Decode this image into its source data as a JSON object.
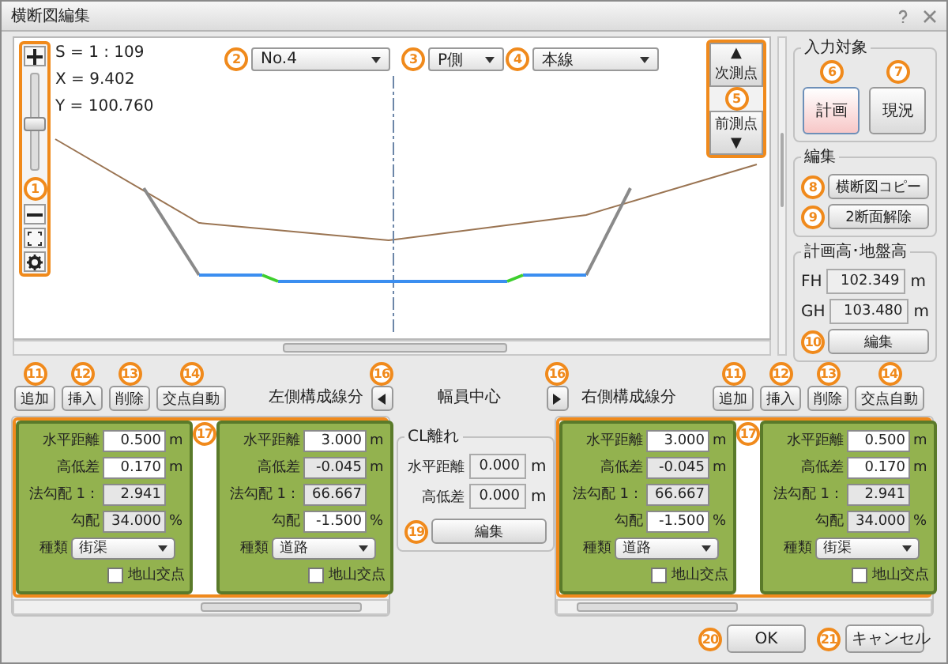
{
  "window": {
    "title": "横断図編集"
  },
  "canvas": {
    "scale": "S = 1 : 109",
    "x": "X = 9.402",
    "y": "Y = 100.760",
    "zoom_slider": {
      "level": 0.48
    },
    "dropdowns": [
      "No.4",
      "P側",
      "本線"
    ],
    "next_button": {
      "icon": "▲",
      "label": "次測点"
    },
    "prev_button": {
      "icon": "▼",
      "label": "前測点"
    }
  },
  "input_target": {
    "title": "入力対象",
    "buttons": [
      {
        "label": "計画",
        "selected": true
      },
      {
        "label": "現況",
        "selected": false
      }
    ]
  },
  "edit_group": {
    "title": "編集",
    "buttons": [
      "横断図コピー",
      "2断面解除"
    ]
  },
  "elevation": {
    "title": "計画高･地盤高",
    "rows": [
      {
        "label": "FH",
        "value": "102.349",
        "unit": "m"
      },
      {
        "label": "GH",
        "value": "103.480",
        "unit": "m"
      }
    ],
    "button": "編集"
  },
  "left_side": {
    "buttons": [
      "追加",
      "挿入",
      "削除",
      "交点自動"
    ],
    "title": "左側構成線分",
    "cards": [
      {
        "fields": [
          {
            "label": "水平距離",
            "value": "0.500",
            "unit": "m",
            "readonly": false
          },
          {
            "label": "高低差",
            "value": "0.170",
            "unit": "m",
            "readonly": false
          },
          {
            "label": "法勾配",
            "prefix": "1：",
            "value": "2.941",
            "readonly": true
          },
          {
            "label": "勾配",
            "value": "34.000",
            "unit": "%",
            "readonly": true
          }
        ],
        "type_label": "種類",
        "type_value": "街渠",
        "check_label": "地山交点",
        "checked": false
      },
      {
        "fields": [
          {
            "label": "水平距離",
            "value": "3.000",
            "unit": "m",
            "readonly": false
          },
          {
            "label": "高低差",
            "value": "-0.045",
            "unit": "m",
            "readonly": true
          },
          {
            "label": "法勾配",
            "prefix": "1：",
            "value": "66.667",
            "readonly": true
          },
          {
            "label": "勾配",
            "value": "-1.500",
            "unit": "%",
            "readonly": false
          }
        ],
        "type_label": "種類",
        "type_value": "道路",
        "check_label": "地山交点",
        "checked": false
      }
    ]
  },
  "center": {
    "title": "幅員中心",
    "group_title": "CL離れ",
    "fields": [
      {
        "label": "水平距離",
        "value": "0.000",
        "unit": "m"
      },
      {
        "label": "高低差",
        "value": "0.000",
        "unit": "m"
      }
    ],
    "button": "編集"
  },
  "right_side": {
    "buttons": [
      "追加",
      "挿入",
      "削除",
      "交点自動"
    ],
    "title": "右側構成線分",
    "cards": [
      {
        "fields": [
          {
            "label": "水平距離",
            "value": "3.000",
            "unit": "m",
            "readonly": false
          },
          {
            "label": "高低差",
            "value": "-0.045",
            "unit": "m",
            "readonly": true
          },
          {
            "label": "法勾配",
            "prefix": "1：",
            "value": "66.667",
            "readonly": true
          },
          {
            "label": "勾配",
            "value": "-1.500",
            "unit": "%",
            "readonly": false
          }
        ],
        "type_label": "種類",
        "type_value": "道路",
        "check_label": "地山交点",
        "checked": false
      },
      {
        "fields": [
          {
            "label": "水平距離",
            "value": "0.500",
            "unit": "m",
            "readonly": false
          },
          {
            "label": "高低差",
            "value": "0.170",
            "unit": "m",
            "readonly": false
          },
          {
            "label": "法勾配",
            "prefix": "1：",
            "value": "2.941",
            "readonly": true
          },
          {
            "label": "勾配",
            "value": "34.000",
            "unit": "%",
            "readonly": true
          }
        ],
        "type_label": "種類",
        "type_value": "街渠",
        "check_label": "地山交点",
        "checked": false
      }
    ]
  },
  "buttons": [
    "OK",
    "キャンセル"
  ],
  "callouts": [
    "1",
    "2",
    "3",
    "4",
    "5",
    "6",
    "7",
    "8",
    "9",
    "10",
    "11",
    "12",
    "13",
    "14",
    "16",
    "17",
    "19",
    "16",
    "11",
    "12",
    "13",
    "14",
    "17",
    "20",
    "21"
  ]
}
